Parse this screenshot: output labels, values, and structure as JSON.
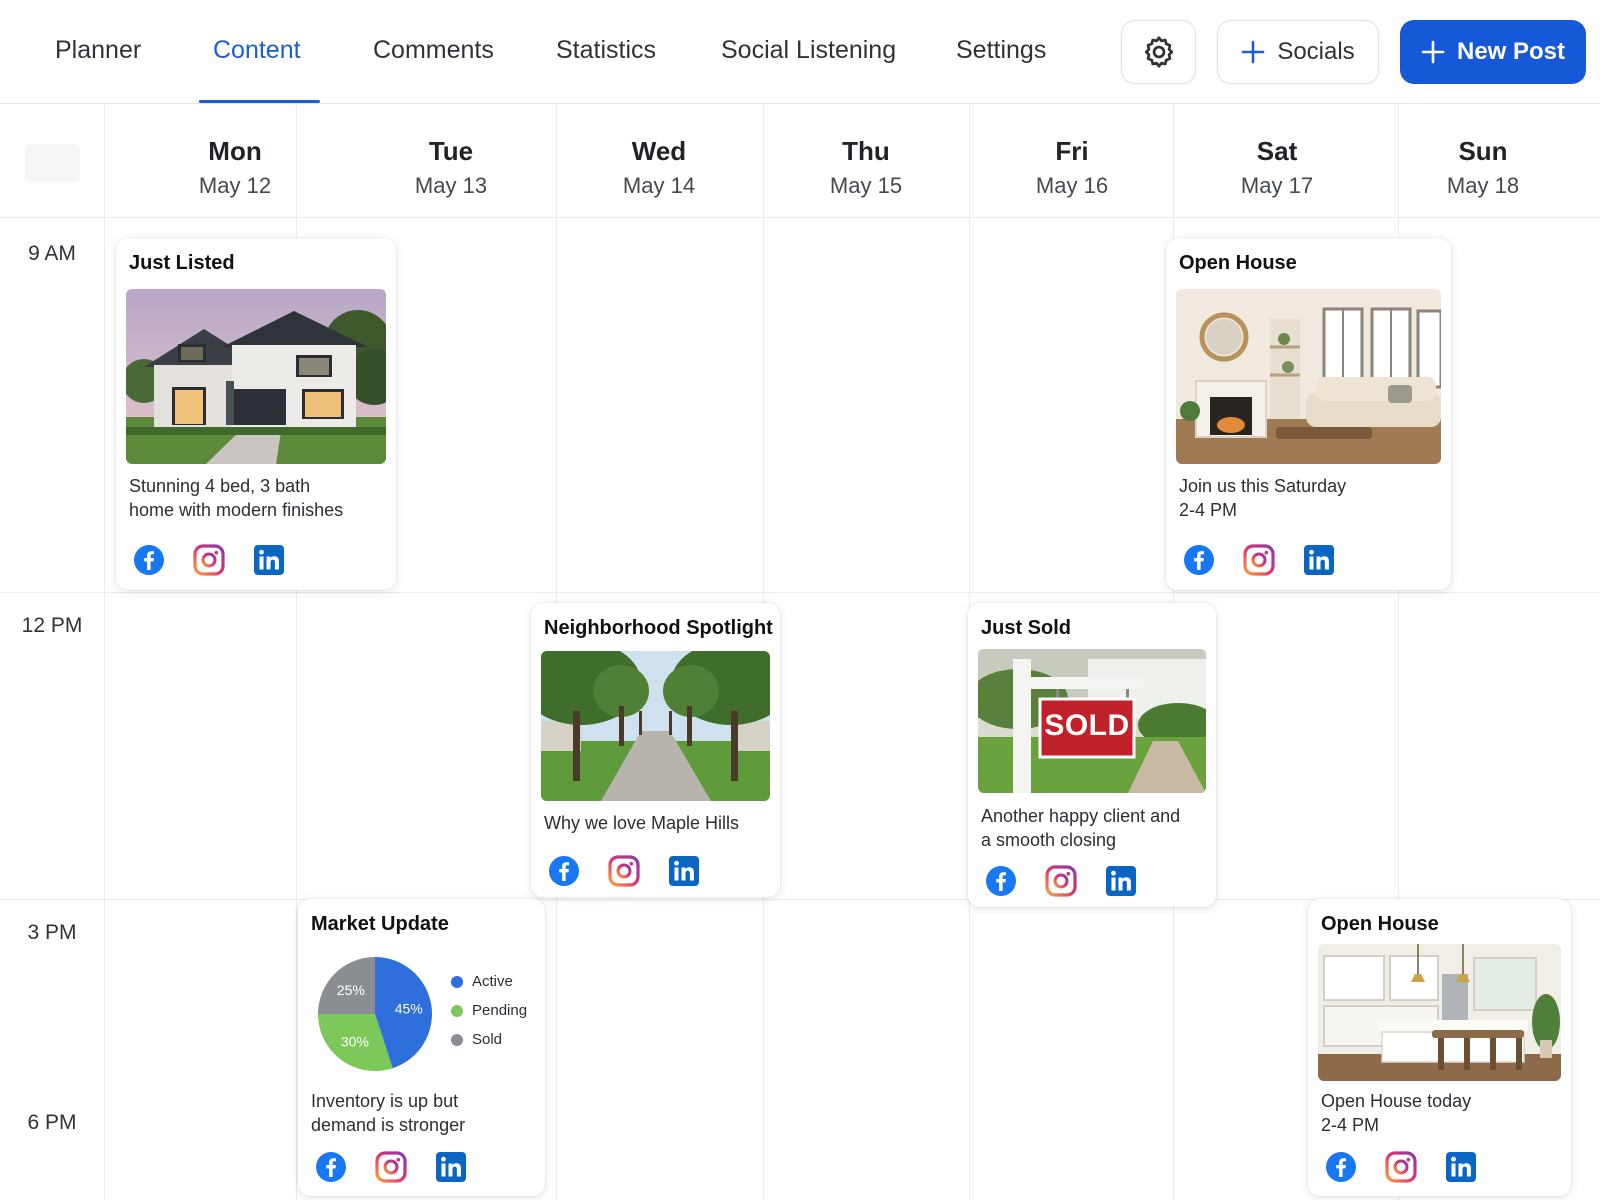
{
  "nav": {
    "tabs": [
      {
        "label": "Planner"
      },
      {
        "label": "Content"
      },
      {
        "label": "Comments"
      },
      {
        "label": "Statistics"
      },
      {
        "label": "Social Listening"
      },
      {
        "label": "Settings"
      }
    ],
    "active_tab": "Content",
    "socials_label": "Socials",
    "new_post_label": "New Post",
    "accent_color": "#1559d9"
  },
  "days": [
    {
      "name": "Mon",
      "date": "May 12"
    },
    {
      "name": "Tue",
      "date": "May 13"
    },
    {
      "name": "Wed",
      "date": "May 14"
    },
    {
      "name": "Thu",
      "date": "May 15"
    },
    {
      "name": "Fri",
      "date": "May 16"
    },
    {
      "name": "Sat",
      "date": "May 17"
    },
    {
      "name": "Sun",
      "date": "May 18"
    }
  ],
  "times": [
    "9 AM",
    "12 PM",
    "3 PM",
    "6 PM"
  ],
  "posts": [
    {
      "title": "Just Listed",
      "text": [
        "Stunning 4 bed, 3 bath",
        "home with modern finishes"
      ],
      "image": "house-exterior"
    },
    {
      "title": "Open House",
      "text": [
        "Join us this Saturday",
        "2-4 PM"
      ],
      "image": "living-room"
    },
    {
      "title": "Neighborhood Spotlight",
      "text": [
        "Why we love Maple Hills"
      ],
      "image": "tree-lined-street"
    },
    {
      "title": "Just Sold",
      "text": [
        "Another happy client and",
        "a smooth closing"
      ],
      "image": "sold-sign",
      "sign_text": "SOLD"
    },
    {
      "title": "Market Update",
      "text": [
        "Inventory is up but",
        "demand is stronger"
      ],
      "image": "pie-chart"
    },
    {
      "title": "Open House",
      "text": [
        "Open House today",
        "2-4 PM"
      ],
      "image": "kitchen"
    }
  ],
  "social_icons": [
    "facebook-icon",
    "instagram-icon",
    "linkedin-icon"
  ],
  "chart_data": {
    "type": "pie",
    "categories": [
      "Active",
      "Pending",
      "Sold"
    ],
    "values": [
      45,
      30,
      25
    ],
    "labels": [
      "45%",
      "30%",
      "25%"
    ],
    "colors": [
      "#2e6fdc",
      "#7cc85a",
      "#8a8d91"
    ],
    "legend": "right"
  }
}
